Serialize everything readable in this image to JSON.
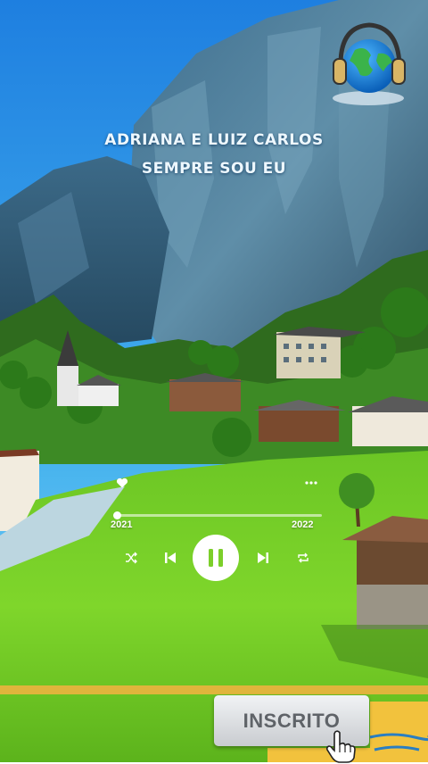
{
  "song": {
    "artist": "ADRIANA E LUIZ CARLOS",
    "title": "SEMPRE SOU EU"
  },
  "player": {
    "time_start": "2021",
    "time_end": "2022",
    "progress": 0.01,
    "state": "playing"
  },
  "subscribe": {
    "label": "INSCRITO"
  },
  "icons": {
    "logo": "globe-headphones-icon",
    "like": "heart-icon",
    "more": "more-dots-icon",
    "shuffle": "shuffle-icon",
    "previous": "skip-previous-icon",
    "play_pause": "pause-icon",
    "next": "skip-next-icon",
    "repeat": "repeat-icon",
    "cursor": "hand-cursor-icon"
  },
  "colors": {
    "sky": "#2f8fe0",
    "grass": "#7dd42a",
    "cliff": "#4a7490",
    "subscribe_bg": "#e3e5e8",
    "subscribe_text": "#5f6368"
  }
}
